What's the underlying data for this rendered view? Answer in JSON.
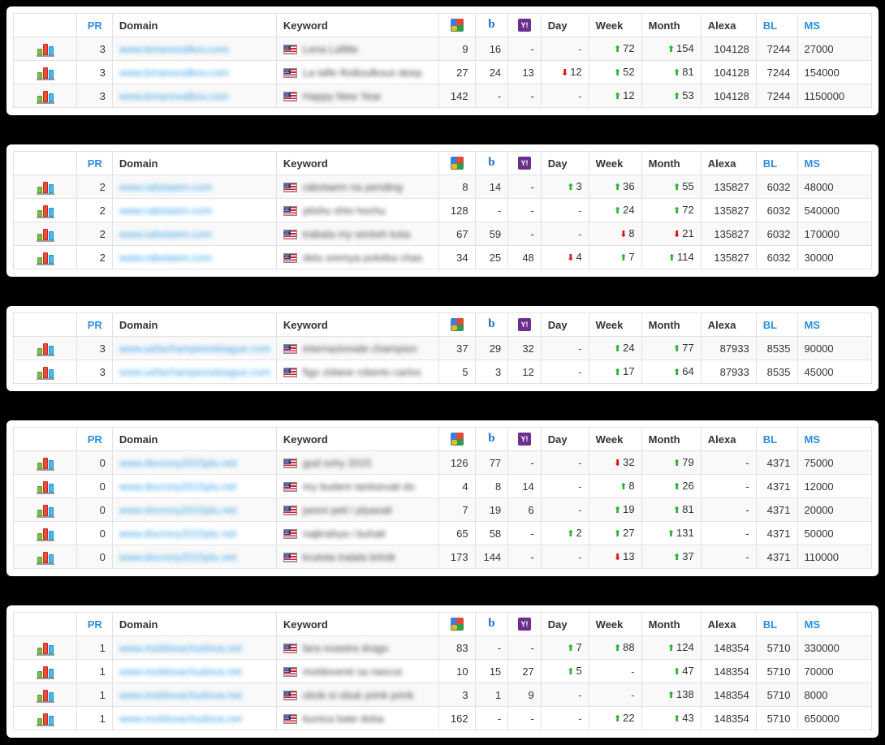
{
  "colors": {
    "page_background": "#000000",
    "panel_background": "#ffffff",
    "link_blue": "#3aa3e8",
    "header_sortable_blue": "#2e8ede",
    "arrow_up_green": "#2db52d",
    "arrow_down_red": "#d81414",
    "row_stripe": "#f9f9f9",
    "border": "#e2e2e2"
  },
  "columns": {
    "chart": {
      "label": "",
      "icon": "bar-chart-icon"
    },
    "pr": "PR",
    "domain": "Domain",
    "keyword": "Keyword",
    "google": {
      "label": "",
      "icon": "google-icon"
    },
    "bing": {
      "label": "",
      "icon": "bing-icon"
    },
    "yahoo": {
      "label": "",
      "icon": "yahoo-icon"
    },
    "day": "Day",
    "week": "Week",
    "month": "Month",
    "alexa": "Alexa",
    "bl": "BL",
    "ms": "MS"
  },
  "panels": [
    {
      "id": "panel-1",
      "rows": [
        {
          "pr": "3",
          "domain": "www.bmanovalkov.com",
          "flag": "us-flag-icon",
          "keyword": "Lena Lafitte",
          "google": "9",
          "bing": "16",
          "yahoo": "-",
          "day": {
            "dir": "none",
            "value": "-"
          },
          "week": {
            "dir": "up",
            "value": "72"
          },
          "month": {
            "dir": "up",
            "value": "154"
          },
          "alexa": "104128",
          "bl": "7244",
          "ms": "27000"
        },
        {
          "pr": "3",
          "domain": "www.bmanovalkov.com",
          "flag": "us-flag-icon",
          "keyword": "La lafle ifodioulkous deep",
          "google": "27",
          "bing": "24",
          "yahoo": "13",
          "day": {
            "dir": "down",
            "value": "12"
          },
          "week": {
            "dir": "up",
            "value": "52"
          },
          "month": {
            "dir": "up",
            "value": "81"
          },
          "alexa": "104128",
          "bl": "7244",
          "ms": "154000"
        },
        {
          "pr": "3",
          "domain": "www.bmanovalkov.com",
          "flag": "us-flag-icon",
          "keyword": "Happy New Year",
          "google": "142",
          "bing": "-",
          "yahoo": "-",
          "day": {
            "dir": "none",
            "value": "-"
          },
          "week": {
            "dir": "up",
            "value": "12"
          },
          "month": {
            "dir": "up",
            "value": "53"
          },
          "alexa": "104128",
          "bl": "7244",
          "ms": "1150000"
        }
      ]
    },
    {
      "id": "panel-2",
      "rows": [
        {
          "pr": "2",
          "domain": "www.rabotaem.com",
          "flag": "us-flag-icon",
          "keyword": "rabotaem na pending",
          "google": "8",
          "bing": "14",
          "yahoo": "-",
          "day": {
            "dir": "up",
            "value": "3"
          },
          "week": {
            "dir": "up",
            "value": "36"
          },
          "month": {
            "dir": "up",
            "value": "55"
          },
          "alexa": "135827",
          "bl": "6032",
          "ms": "48000"
        },
        {
          "pr": "2",
          "domain": "www.rabotaem.com",
          "flag": "us-flag-icon",
          "keyword": "ptishu shto hochu",
          "google": "128",
          "bing": "-",
          "yahoo": "-",
          "day": {
            "dir": "none",
            "value": "-"
          },
          "week": {
            "dir": "up",
            "value": "24"
          },
          "month": {
            "dir": "up",
            "value": "72"
          },
          "alexa": "135827",
          "bl": "6032",
          "ms": "540000"
        },
        {
          "pr": "2",
          "domain": "www.rabotaem.com",
          "flag": "us-flag-icon",
          "keyword": "trabala my wickeh kota",
          "google": "67",
          "bing": "59",
          "yahoo": "-",
          "day": {
            "dir": "none",
            "value": "-"
          },
          "week": {
            "dir": "down",
            "value": "8"
          },
          "month": {
            "dir": "down",
            "value": "21"
          },
          "alexa": "135827",
          "bl": "6032",
          "ms": "170000"
        },
        {
          "pr": "2",
          "domain": "www.rabotaem.com",
          "flag": "us-flag-icon",
          "keyword": "delu sremya polotka chas",
          "google": "34",
          "bing": "25",
          "yahoo": "48",
          "day": {
            "dir": "down",
            "value": "4"
          },
          "week": {
            "dir": "up",
            "value": "7"
          },
          "month": {
            "dir": "up",
            "value": "114"
          },
          "alexa": "135827",
          "bl": "6032",
          "ms": "30000"
        }
      ]
    },
    {
      "id": "panel-3",
      "rows": [
        {
          "pr": "3",
          "domain": "www.uefachampionsleague.com",
          "flag": "us-flag-icon",
          "keyword": "internazionale champion",
          "google": "37",
          "bing": "29",
          "yahoo": "32",
          "day": {
            "dir": "none",
            "value": "-"
          },
          "week": {
            "dir": "up",
            "value": "24"
          },
          "month": {
            "dir": "up",
            "value": "77"
          },
          "alexa": "87933",
          "bl": "8535",
          "ms": "90000"
        },
        {
          "pr": "3",
          "domain": "www.uefachampionsleague.com",
          "flag": "us-flag-icon",
          "keyword": "figo zidane roberto carlos",
          "google": "5",
          "bing": "3",
          "yahoo": "12",
          "day": {
            "dir": "none",
            "value": "-"
          },
          "week": {
            "dir": "up",
            "value": "17"
          },
          "month": {
            "dir": "up",
            "value": "64"
          },
          "alexa": "87933",
          "bl": "8535",
          "ms": "45000"
        }
      ]
    },
    {
      "id": "panel-4",
      "rows": [
        {
          "pr": "0",
          "domain": "www.dscrony2015plu.net",
          "flag": "us-flag-icon",
          "keyword": "god svhy 2015",
          "google": "126",
          "bing": "77",
          "yahoo": "-",
          "day": {
            "dir": "none",
            "value": "-"
          },
          "week": {
            "dir": "down",
            "value": "32"
          },
          "month": {
            "dir": "up",
            "value": "79"
          },
          "alexa": "-",
          "bl": "4371",
          "ms": "75000"
        },
        {
          "pr": "0",
          "domain": "www.dscrony2015plu.net",
          "flag": "us-flag-icon",
          "keyword": "my budem tantsevati do",
          "google": "4",
          "bing": "8",
          "yahoo": "14",
          "day": {
            "dir": "none",
            "value": "-"
          },
          "week": {
            "dir": "up",
            "value": "8"
          },
          "month": {
            "dir": "up",
            "value": "26"
          },
          "alexa": "-",
          "bl": "4371",
          "ms": "12000"
        },
        {
          "pr": "0",
          "domain": "www.dscrony2015plu.net",
          "flag": "us-flag-icon",
          "keyword": "pesni peti i plyasati",
          "google": "7",
          "bing": "19",
          "yahoo": "6",
          "day": {
            "dir": "none",
            "value": "-"
          },
          "week": {
            "dir": "up",
            "value": "19"
          },
          "month": {
            "dir": "up",
            "value": "81"
          },
          "alexa": "-",
          "bl": "4371",
          "ms": "20000"
        },
        {
          "pr": "0",
          "domain": "www.dscrony2015plu.net",
          "flag": "us-flag-icon",
          "keyword": "najkrahya i buhati",
          "google": "65",
          "bing": "58",
          "yahoo": "-",
          "day": {
            "dir": "up",
            "value": "2"
          },
          "week": {
            "dir": "up",
            "value": "27"
          },
          "month": {
            "dir": "up",
            "value": "131"
          },
          "alexa": "-",
          "bl": "4371",
          "ms": "50000"
        },
        {
          "pr": "0",
          "domain": "www.dscrony2015plu.net",
          "flag": "us-flag-icon",
          "keyword": "krutota tralala brtnik",
          "google": "173",
          "bing": "144",
          "yahoo": "-",
          "day": {
            "dir": "none",
            "value": "-"
          },
          "week": {
            "dir": "down",
            "value": "13"
          },
          "month": {
            "dir": "up",
            "value": "37"
          },
          "alexa": "-",
          "bl": "4371",
          "ms": "110000"
        }
      ]
    },
    {
      "id": "panel-5",
      "rows": [
        {
          "pr": "1",
          "domain": "www.moldovachudova.net",
          "flag": "us-flag-icon",
          "keyword": "lara noastra drago",
          "google": "83",
          "bing": "-",
          "yahoo": "-",
          "day": {
            "dir": "up",
            "value": "7"
          },
          "week": {
            "dir": "up",
            "value": "88"
          },
          "month": {
            "dir": "up",
            "value": "124"
          },
          "alexa": "148354",
          "bl": "5710",
          "ms": "330000"
        },
        {
          "pr": "1",
          "domain": "www.moldovachudova.net",
          "flag": "us-flag-icon",
          "keyword": "moldoventi sa nascut",
          "google": "10",
          "bing": "15",
          "yahoo": "27",
          "day": {
            "dir": "up",
            "value": "5"
          },
          "week": {
            "dir": "none",
            "value": "-"
          },
          "month": {
            "dir": "up",
            "value": "47"
          },
          "alexa": "148354",
          "bl": "5710",
          "ms": "70000"
        },
        {
          "pr": "1",
          "domain": "www.moldovachudova.net",
          "flag": "us-flag-icon",
          "keyword": "obok si obuk prink prink",
          "google": "3",
          "bing": "1",
          "yahoo": "9",
          "day": {
            "dir": "none",
            "value": "-"
          },
          "week": {
            "dir": "none",
            "value": "-"
          },
          "month": {
            "dir": "up",
            "value": "138"
          },
          "alexa": "148354",
          "bl": "5710",
          "ms": "8000"
        },
        {
          "pr": "1",
          "domain": "www.moldovachudova.net",
          "flag": "us-flag-icon",
          "keyword": "bunica bate doba",
          "google": "162",
          "bing": "-",
          "yahoo": "-",
          "day": {
            "dir": "none",
            "value": "-"
          },
          "week": {
            "dir": "up",
            "value": "22"
          },
          "month": {
            "dir": "up",
            "value": "43"
          },
          "alexa": "148354",
          "bl": "5710",
          "ms": "650000"
        }
      ]
    }
  ]
}
